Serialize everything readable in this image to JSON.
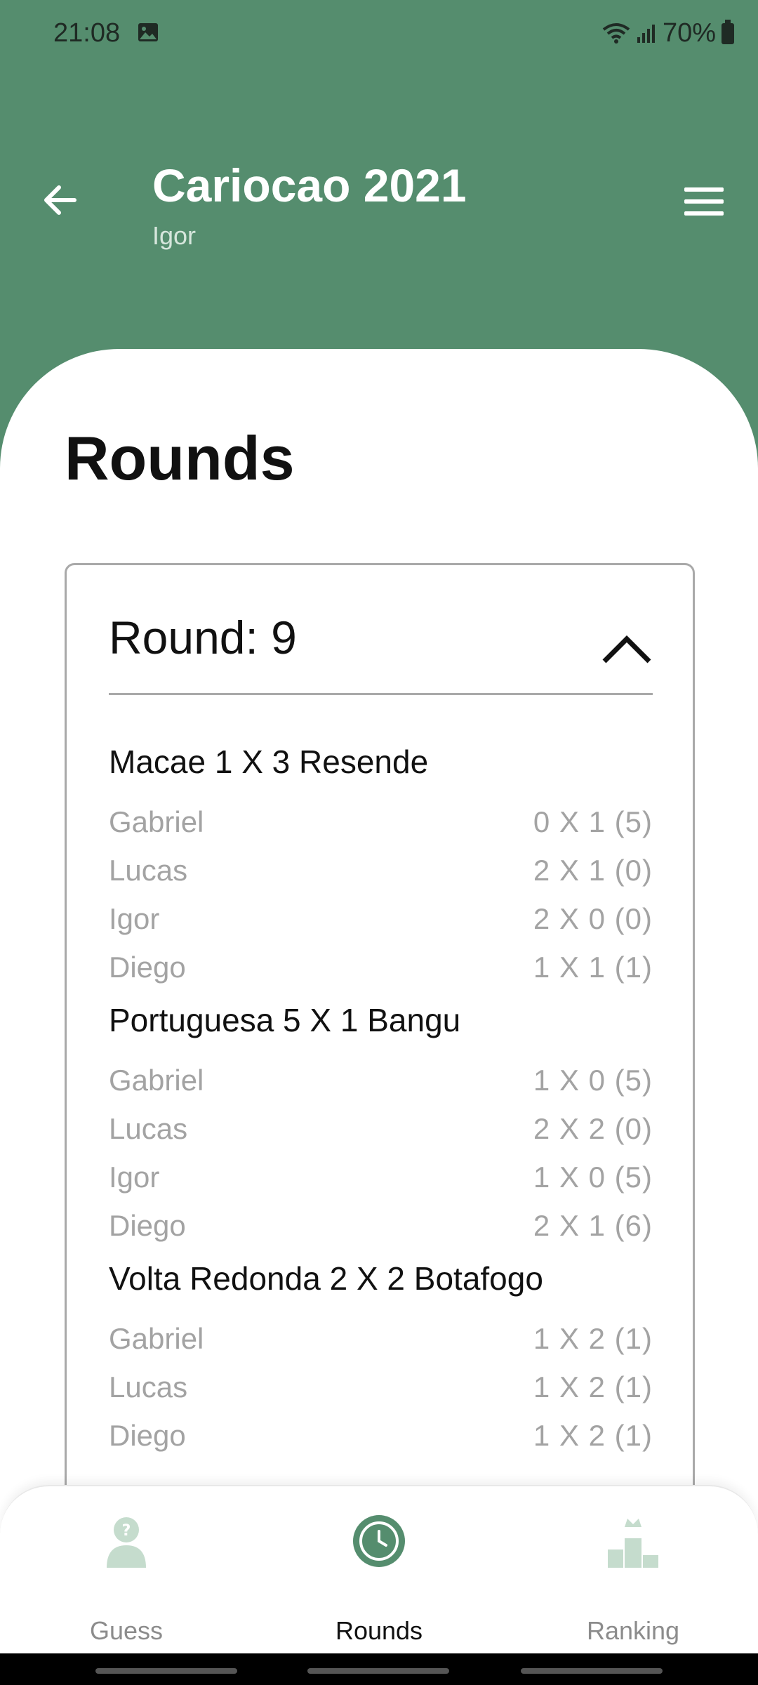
{
  "status": {
    "time": "21:08",
    "battery": "70%"
  },
  "header": {
    "title": "Cariocao 2021",
    "subtitle": "Igor"
  },
  "page": {
    "title": "Rounds"
  },
  "round": {
    "label": "Round: 9",
    "games": [
      {
        "title": "Macae 1 X 3 Resende",
        "guesses": [
          {
            "name": "Gabriel",
            "score": "0 X 1 (5)"
          },
          {
            "name": "Lucas",
            "score": "2 X 1 (0)"
          },
          {
            "name": "Igor",
            "score": "2 X 0 (0)"
          },
          {
            "name": "Diego",
            "score": "1 X 1 (1)"
          }
        ]
      },
      {
        "title": "Portuguesa 5 X 1 Bangu",
        "guesses": [
          {
            "name": "Gabriel",
            "score": "1 X 0 (5)"
          },
          {
            "name": "Lucas",
            "score": "2 X 2 (0)"
          },
          {
            "name": "Igor",
            "score": "1 X 0 (5)"
          },
          {
            "name": "Diego",
            "score": "2 X 1 (6)"
          }
        ]
      },
      {
        "title": "Volta Redonda 2 X 2 Botafogo",
        "guesses": [
          {
            "name": "Gabriel",
            "score": "1 X 2 (1)"
          },
          {
            "name": "Lucas",
            "score": "1 X 2 (1)"
          },
          {
            "name": "Diego",
            "score": "1 X 2 (1)"
          }
        ]
      }
    ]
  },
  "nav": {
    "items": [
      {
        "label": "Guess",
        "icon": "guess-person-icon"
      },
      {
        "label": "Rounds",
        "icon": "clock-icon"
      },
      {
        "label": "Ranking",
        "icon": "podium-icon"
      }
    ]
  },
  "colors": {
    "primary": "#558d6e",
    "muted": "#a3a3a3",
    "icon_faded": "#c5dccd"
  }
}
